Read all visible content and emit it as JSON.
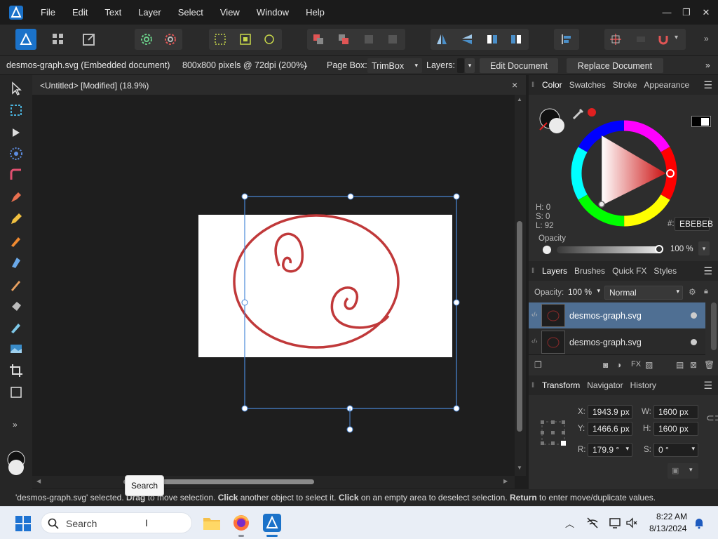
{
  "menubar": {
    "items": [
      "File",
      "Edit",
      "Text",
      "Layer",
      "Select",
      "View",
      "Window",
      "Help"
    ]
  },
  "contextbar": {
    "document_name": "desmos-graph.svg (Embedded document)",
    "size_info": "800x800 pixels @ 72dpi (200%)",
    "page_box_label": "Page Box:",
    "page_box_value": "TrimBox",
    "layers_label": "Layers:",
    "edit_document": "Edit Document",
    "replace_document": "Replace Document"
  },
  "doctab": {
    "title": "<Untitled> [Modified] (18.9%)",
    "close": "×"
  },
  "color_panel": {
    "tabs": [
      "Color",
      "Swatches",
      "Stroke",
      "Appearance"
    ],
    "hsl": {
      "h": "H: 0",
      "s": "S: 0",
      "l": "L: 92"
    },
    "hex_prefix": "#:",
    "hex_value": "EBEBEB",
    "opacity_label": "Opacity",
    "opacity_value": "100 %",
    "accent_color": "#e02020"
  },
  "layers_panel": {
    "tabs": [
      "Layers",
      "Brushes",
      "Quick FX",
      "Styles"
    ],
    "opacity_label": "Opacity:",
    "opacity_value": "100 %",
    "blend_mode": "Normal",
    "layers": [
      {
        "name": "desmos-graph.svg",
        "selected": true
      },
      {
        "name": "desmos-graph.svg",
        "selected": false
      }
    ]
  },
  "transform_panel": {
    "tabs": [
      "Transform",
      "Navigator",
      "History"
    ],
    "x_label": "X:",
    "x_value": "1943.9 px",
    "y_label": "Y:",
    "y_value": "1466.6 px",
    "w_label": "W:",
    "w_value": "1600 px",
    "h_label": "H:",
    "h_value": "1600 px",
    "r_label": "R:",
    "r_value": "179.9 °",
    "s_label": "S:",
    "s_value": "0 °"
  },
  "statusbar": {
    "part1": "'desmos-graph.svg' selected. ",
    "drag": "Drag",
    "part2": " to move selection. ",
    "click": "Click",
    "part3": " another object to select it. ",
    "click2": "Click",
    "part4": " on an empty area to deselect selection. ",
    "return": "Return",
    "part5": " to enter move/duplicate values."
  },
  "tooltip": {
    "text": "Search"
  },
  "taskbar": {
    "search_placeholder": "Search",
    "time": "8:22 AM",
    "date": "8/13/2024"
  }
}
